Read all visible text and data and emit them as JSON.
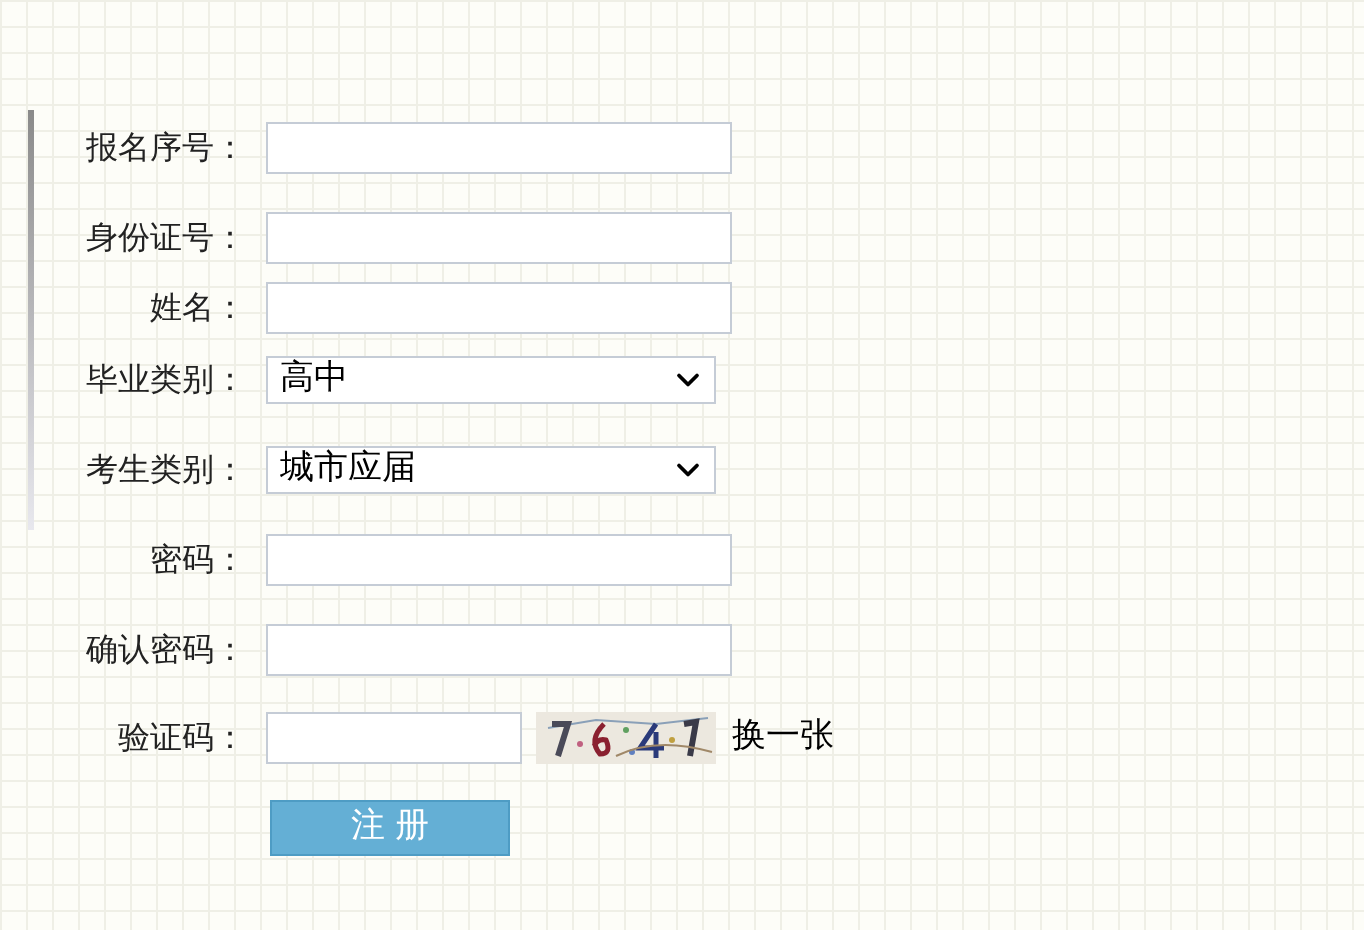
{
  "form": {
    "rows": [
      {
        "kind": "text",
        "label": "报名序号："
      },
      {
        "kind": "text",
        "label": "身份证号："
      },
      {
        "kind": "text",
        "label": "姓名："
      },
      {
        "kind": "select",
        "label": "毕业类别：",
        "value": "高中"
      },
      {
        "kind": "select",
        "label": "考生类别：",
        "value": "城市应届"
      },
      {
        "kind": "text",
        "label": "密码："
      },
      {
        "kind": "text",
        "label": "确认密码："
      },
      {
        "kind": "captcha",
        "label": "验证码：",
        "refresh": "换一张"
      }
    ],
    "submit": "注 册"
  }
}
